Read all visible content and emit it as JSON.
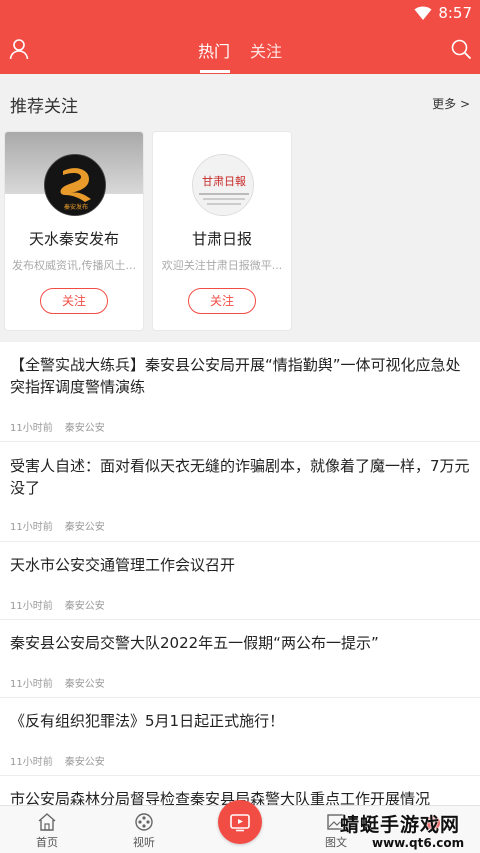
{
  "status_bar": {
    "time": "8:57",
    "wifi_icon": "wifi-icon"
  },
  "header": {
    "tabs": [
      {
        "label": "热门"
      },
      {
        "label": "关注"
      }
    ],
    "user_icon": "user-icon",
    "search_icon": "search-icon",
    "color": "#f24d44"
  },
  "recommend": {
    "title": "推荐关注",
    "more": "更多 >",
    "cards": [
      {
        "name": "天水秦安发布",
        "desc": "发布权威资讯,传播风土...",
        "button": "关注",
        "logo_text": "秦安发布"
      },
      {
        "name": "甘肃日报",
        "desc": "欢迎关注甘肃日报微平...",
        "button": "关注",
        "logo_text": "甘肃日報"
      }
    ]
  },
  "news": [
    {
      "title": "【全警实战大练兵】秦安县公安局开展“情指勤舆”一体可视化应急处突指挥调度警情演练",
      "time": "11小时前",
      "source": "秦安公安"
    },
    {
      "title": "受害人自述：面对看似天衣无缝的诈骗剧本，就像着了魔一样，7万元没了",
      "time": "11小时前",
      "source": "秦安公安"
    },
    {
      "title": "天水市公安交通管理工作会议召开",
      "time": "11小时前",
      "source": "秦安公安"
    },
    {
      "title": "秦安县公安局交警大队2022年五一假期“两公布一提示”",
      "time": "11小时前",
      "source": "秦安公安"
    },
    {
      "title": "《反有组织犯罪法》5月1日起正式施行！",
      "time": "11小时前",
      "source": "秦安公安"
    },
    {
      "title": "市公安局森林分局督导检查秦安县局森警大队重点工作开展情况",
      "time": "",
      "source": ""
    }
  ],
  "bottom_nav": {
    "items": [
      {
        "label": "首页"
      },
      {
        "label": "视听"
      },
      {
        "label": "图文"
      }
    ],
    "center_icon": "tv-icon"
  },
  "watermark": {
    "line1": "蜻蜓手游戏网",
    "line2": "www.qt6.com"
  }
}
